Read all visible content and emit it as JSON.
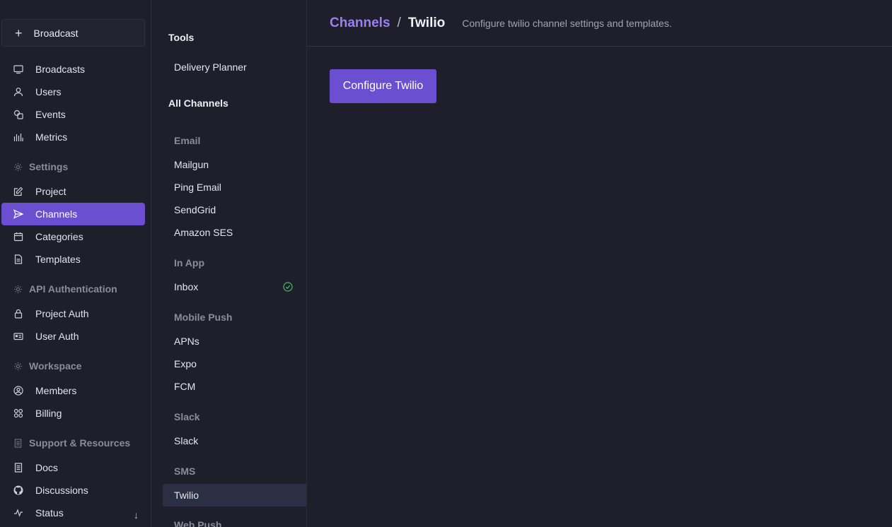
{
  "sidebar": {
    "broadcast_button": "Broadcast",
    "items": {
      "broadcasts": "Broadcasts",
      "users": "Users",
      "events": "Events",
      "metrics": "Metrics",
      "project": "Project",
      "channels": "Channels",
      "categories": "Categories",
      "templates": "Templates",
      "project_auth": "Project Auth",
      "user_auth": "User Auth",
      "members": "Members",
      "billing": "Billing",
      "docs": "Docs",
      "discussions": "Discussions",
      "status": "Status"
    },
    "sections": {
      "settings": "Settings",
      "api_auth": "API Authentication",
      "workspace": "Workspace",
      "support": "Support & Resources"
    },
    "active_item": "Channels",
    "scroll_indicator": "↓"
  },
  "subnav": {
    "tools_heading": "Tools",
    "delivery_planner": "Delivery Planner",
    "all_channels_heading": "All Channels",
    "groups": {
      "email": "Email",
      "in_app": "In App",
      "mobile_push": "Mobile Push",
      "slack": "Slack",
      "sms": "SMS",
      "web_push": "Web Push"
    },
    "items": {
      "mailgun": "Mailgun",
      "ping_email": "Ping Email",
      "sendgrid": "SendGrid",
      "amazon_ses": "Amazon SES",
      "inbox": "Inbox",
      "apns": "APNs",
      "expo": "Expo",
      "fcm": "FCM",
      "slack": "Slack",
      "twilio": "Twilio"
    },
    "active_item": "Twilio"
  },
  "main": {
    "breadcrumb_parent": "Channels",
    "breadcrumb_separator": "/",
    "breadcrumb_current": "Twilio",
    "description": "Configure twilio channel settings and templates.",
    "configure_button": "Configure Twilio"
  },
  "colors": {
    "accent": "#6a4fd0",
    "link": "#9c7ff5",
    "success": "#3fbf6a",
    "background": "#1e1f2b"
  }
}
